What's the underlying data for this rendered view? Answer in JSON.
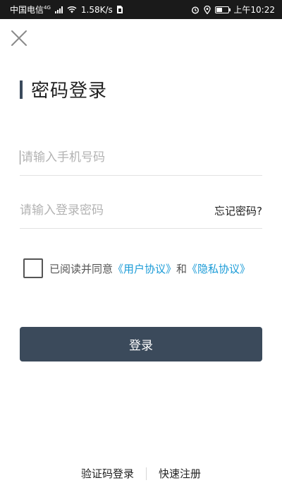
{
  "status_bar": {
    "carrier": "中国电信",
    "network": "4G",
    "speed": "1.58K/s",
    "time": "上午10:22"
  },
  "title": "密码登录",
  "phone_field": {
    "placeholder": "请输入手机号码",
    "value": ""
  },
  "password_field": {
    "placeholder": "请输入登录密码",
    "value": ""
  },
  "forgot_label": "忘记密码?",
  "agreement": {
    "prefix": "已阅读并同意",
    "user_agreement": "《用户协议》",
    "and": "和",
    "privacy_agreement": "《隐私协议》",
    "checked": false
  },
  "login_label": "登录",
  "bottom_links": {
    "sms_login": "验证码登录",
    "quick_register": "快速注册"
  },
  "colors": {
    "accent": "#3b4a5b",
    "link": "#1a9bd7"
  }
}
